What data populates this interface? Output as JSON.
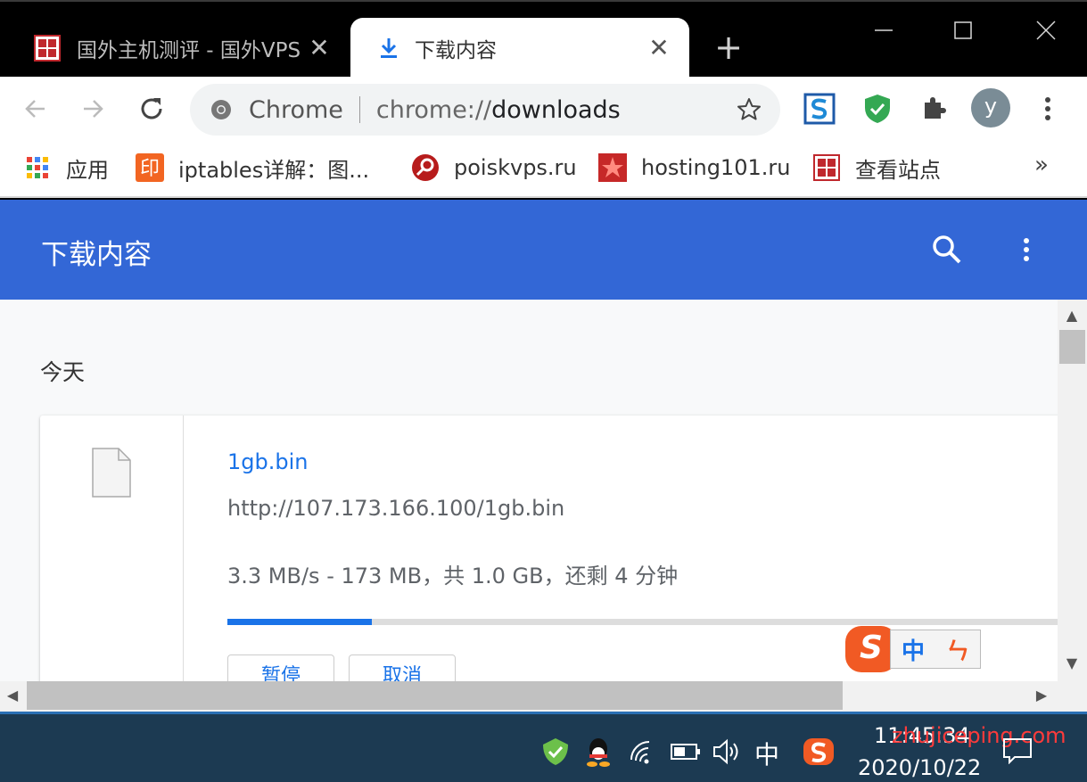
{
  "tabs": [
    {
      "title": "国外主机测评 - 国外VPS",
      "active": false
    },
    {
      "title": "下载内容",
      "active": true
    }
  ],
  "toolbar": {
    "site_label": "Chrome",
    "url_prefix": "chrome://",
    "url_path": "downloads",
    "avatar_letter": "y"
  },
  "bookmarks": [
    {
      "label": "应用",
      "icon": "apps-grid-icon"
    },
    {
      "label": "iptables详解：图...",
      "icon": "yin-bookmark-icon"
    },
    {
      "label": "poiskvps.ru",
      "icon": "poiskvps-icon"
    },
    {
      "label": "hosting101.ru",
      "icon": "star-bookmark-icon"
    },
    {
      "label": "查看站点",
      "icon": "seal-bookmark-icon"
    }
  ],
  "bookmarks_more": "»",
  "page": {
    "title": "下载内容",
    "section": "今天"
  },
  "download": {
    "filename": "1gb.bin",
    "url": "http://107.173.166.100/1gb.bin",
    "status": "3.3 MB/s - 173 MB，共 1.0 GB，还剩 4 分钟",
    "progress": 0.17,
    "pause_label": "暂停",
    "cancel_label": "取消"
  },
  "ime": {
    "logo": "S",
    "mode": "中",
    "tool": "ㄣ"
  },
  "taskbar": {
    "ime_mode": "中",
    "time": "11:45:34",
    "date": "2020/10/22",
    "watermark": "zhujiceping.com"
  },
  "colors": {
    "header_blue": "#3367d6",
    "link_blue": "#1a73e8",
    "taskbar": "#1c3a52"
  }
}
